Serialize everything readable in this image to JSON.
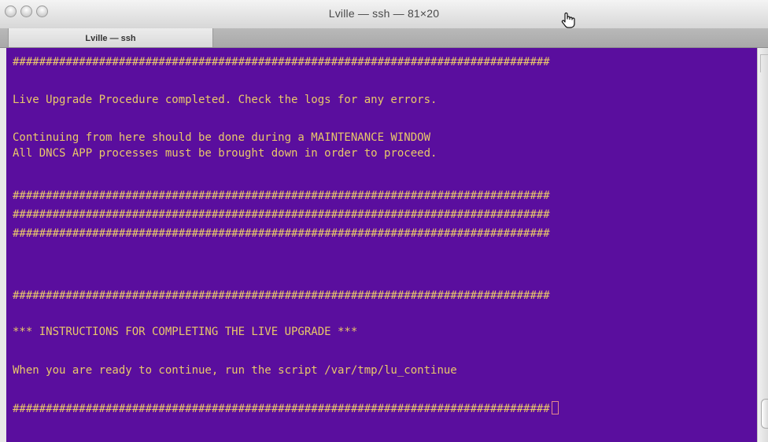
{
  "window": {
    "title": "Lville — ssh — 81×20"
  },
  "tabs": [
    {
      "label": "Lville — ssh"
    }
  ],
  "terminal": {
    "colors": {
      "background": "#5a0e9e",
      "text": "#e9c86a",
      "cursor": "#e48a8a"
    },
    "lines": [
      "#################################################################################",
      "",
      "Live Upgrade Procedure completed. Check the logs for any errors.",
      "",
      "Continuing from here should be done during a MAINTENANCE WINDOW",
      "All DNCS APP processes must be brought down in order to proceed.",
      "",
      "#################################################################################",
      "#################################################################################",
      "#################################################################################",
      "",
      "",
      "#################################################################################",
      "",
      "*** INSTRUCTIONS FOR COMPLETING THE LIVE UPGRADE ***",
      "",
      "When you are ready to continue, run the script /var/tmp/lu_continue",
      "",
      "#################################################################################"
    ]
  },
  "icons": {
    "close": "close-icon",
    "minimize": "minimize-icon",
    "zoom": "zoom-icon",
    "pointer": "hand-pointer-icon"
  }
}
